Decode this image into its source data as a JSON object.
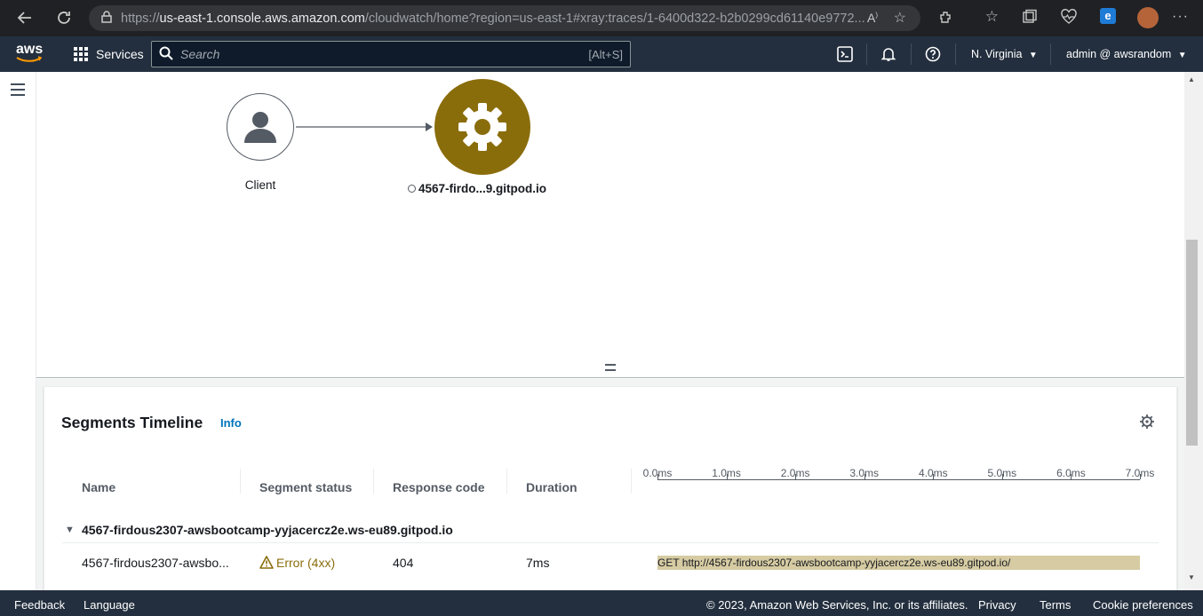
{
  "browser": {
    "url_prefix": "https://",
    "url_host": "us-east-1.console.aws.amazon.com",
    "url_rest": "/cloudwatch/home?region=us-east-1#xray:traces/1-6400d322-b2b0299cd61140e9772..."
  },
  "aws_nav": {
    "services_label": "Services",
    "search_placeholder": "Search",
    "search_shortcut": "[Alt+S]",
    "region": "N. Virginia",
    "account": "admin @ awsrandom"
  },
  "service_map": {
    "client_label": "Client",
    "node_label": "4567-firdo...9.gitpod.io",
    "node_color": "#8a6d0b"
  },
  "segments_timeline": {
    "title": "Segments Timeline",
    "info_link": "Info",
    "columns": [
      "Name",
      "Segment status",
      "Response code",
      "Duration"
    ],
    "ticks": [
      "0.0ms",
      "1.0ms",
      "2.0ms",
      "3.0ms",
      "4.0ms",
      "5.0ms",
      "6.0ms",
      "7.0ms"
    ],
    "group_name": "4567-firdous2307-awsbootcamp-yyjacercz2e.ws-eu89.gitpod.io",
    "row": {
      "name": "4567-firdous2307-awsbo...",
      "status": "Error (4xx)",
      "response_code": "404",
      "duration": "7ms",
      "bar_label": "GET http://4567-firdous2307-awsbootcamp-yyjacercz2e.ws-eu89.gitpod.io/",
      "bar_start_ms": 0,
      "bar_end_ms": 7,
      "bar_color": "#d6cba2"
    }
  },
  "footer": {
    "feedback": "Feedback",
    "language": "Language",
    "copyright": "© 2023, Amazon Web Services, Inc. or its affiliates.",
    "privacy": "Privacy",
    "terms": "Terms",
    "cookie": "Cookie preferences"
  }
}
